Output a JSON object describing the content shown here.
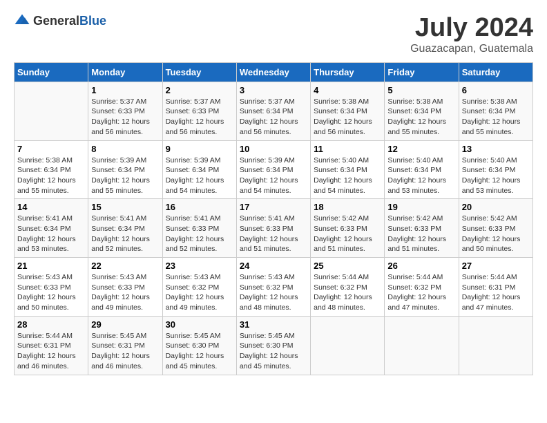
{
  "header": {
    "logo_general": "General",
    "logo_blue": "Blue",
    "month_title": "July 2024",
    "location": "Guazacapan, Guatemala"
  },
  "calendar": {
    "days_of_week": [
      "Sunday",
      "Monday",
      "Tuesday",
      "Wednesday",
      "Thursday",
      "Friday",
      "Saturday"
    ],
    "weeks": [
      [
        {
          "day": "",
          "info": ""
        },
        {
          "day": "1",
          "info": "Sunrise: 5:37 AM\nSunset: 6:33 PM\nDaylight: 12 hours\nand 56 minutes."
        },
        {
          "day": "2",
          "info": "Sunrise: 5:37 AM\nSunset: 6:33 PM\nDaylight: 12 hours\nand 56 minutes."
        },
        {
          "day": "3",
          "info": "Sunrise: 5:37 AM\nSunset: 6:34 PM\nDaylight: 12 hours\nand 56 minutes."
        },
        {
          "day": "4",
          "info": "Sunrise: 5:38 AM\nSunset: 6:34 PM\nDaylight: 12 hours\nand 56 minutes."
        },
        {
          "day": "5",
          "info": "Sunrise: 5:38 AM\nSunset: 6:34 PM\nDaylight: 12 hours\nand 55 minutes."
        },
        {
          "day": "6",
          "info": "Sunrise: 5:38 AM\nSunset: 6:34 PM\nDaylight: 12 hours\nand 55 minutes."
        }
      ],
      [
        {
          "day": "7",
          "info": "Sunrise: 5:38 AM\nSunset: 6:34 PM\nDaylight: 12 hours\nand 55 minutes."
        },
        {
          "day": "8",
          "info": "Sunrise: 5:39 AM\nSunset: 6:34 PM\nDaylight: 12 hours\nand 55 minutes."
        },
        {
          "day": "9",
          "info": "Sunrise: 5:39 AM\nSunset: 6:34 PM\nDaylight: 12 hours\nand 54 minutes."
        },
        {
          "day": "10",
          "info": "Sunrise: 5:39 AM\nSunset: 6:34 PM\nDaylight: 12 hours\nand 54 minutes."
        },
        {
          "day": "11",
          "info": "Sunrise: 5:40 AM\nSunset: 6:34 PM\nDaylight: 12 hours\nand 54 minutes."
        },
        {
          "day": "12",
          "info": "Sunrise: 5:40 AM\nSunset: 6:34 PM\nDaylight: 12 hours\nand 53 minutes."
        },
        {
          "day": "13",
          "info": "Sunrise: 5:40 AM\nSunset: 6:34 PM\nDaylight: 12 hours\nand 53 minutes."
        }
      ],
      [
        {
          "day": "14",
          "info": "Sunrise: 5:41 AM\nSunset: 6:34 PM\nDaylight: 12 hours\nand 53 minutes."
        },
        {
          "day": "15",
          "info": "Sunrise: 5:41 AM\nSunset: 6:34 PM\nDaylight: 12 hours\nand 52 minutes."
        },
        {
          "day": "16",
          "info": "Sunrise: 5:41 AM\nSunset: 6:33 PM\nDaylight: 12 hours\nand 52 minutes."
        },
        {
          "day": "17",
          "info": "Sunrise: 5:41 AM\nSunset: 6:33 PM\nDaylight: 12 hours\nand 51 minutes."
        },
        {
          "day": "18",
          "info": "Sunrise: 5:42 AM\nSunset: 6:33 PM\nDaylight: 12 hours\nand 51 minutes."
        },
        {
          "day": "19",
          "info": "Sunrise: 5:42 AM\nSunset: 6:33 PM\nDaylight: 12 hours\nand 51 minutes."
        },
        {
          "day": "20",
          "info": "Sunrise: 5:42 AM\nSunset: 6:33 PM\nDaylight: 12 hours\nand 50 minutes."
        }
      ],
      [
        {
          "day": "21",
          "info": "Sunrise: 5:43 AM\nSunset: 6:33 PM\nDaylight: 12 hours\nand 50 minutes."
        },
        {
          "day": "22",
          "info": "Sunrise: 5:43 AM\nSunset: 6:33 PM\nDaylight: 12 hours\nand 49 minutes."
        },
        {
          "day": "23",
          "info": "Sunrise: 5:43 AM\nSunset: 6:32 PM\nDaylight: 12 hours\nand 49 minutes."
        },
        {
          "day": "24",
          "info": "Sunrise: 5:43 AM\nSunset: 6:32 PM\nDaylight: 12 hours\nand 48 minutes."
        },
        {
          "day": "25",
          "info": "Sunrise: 5:44 AM\nSunset: 6:32 PM\nDaylight: 12 hours\nand 48 minutes."
        },
        {
          "day": "26",
          "info": "Sunrise: 5:44 AM\nSunset: 6:32 PM\nDaylight: 12 hours\nand 47 minutes."
        },
        {
          "day": "27",
          "info": "Sunrise: 5:44 AM\nSunset: 6:31 PM\nDaylight: 12 hours\nand 47 minutes."
        }
      ],
      [
        {
          "day": "28",
          "info": "Sunrise: 5:44 AM\nSunset: 6:31 PM\nDaylight: 12 hours\nand 46 minutes."
        },
        {
          "day": "29",
          "info": "Sunrise: 5:45 AM\nSunset: 6:31 PM\nDaylight: 12 hours\nand 46 minutes."
        },
        {
          "day": "30",
          "info": "Sunrise: 5:45 AM\nSunset: 6:30 PM\nDaylight: 12 hours\nand 45 minutes."
        },
        {
          "day": "31",
          "info": "Sunrise: 5:45 AM\nSunset: 6:30 PM\nDaylight: 12 hours\nand 45 minutes."
        },
        {
          "day": "",
          "info": ""
        },
        {
          "day": "",
          "info": ""
        },
        {
          "day": "",
          "info": ""
        }
      ]
    ]
  }
}
